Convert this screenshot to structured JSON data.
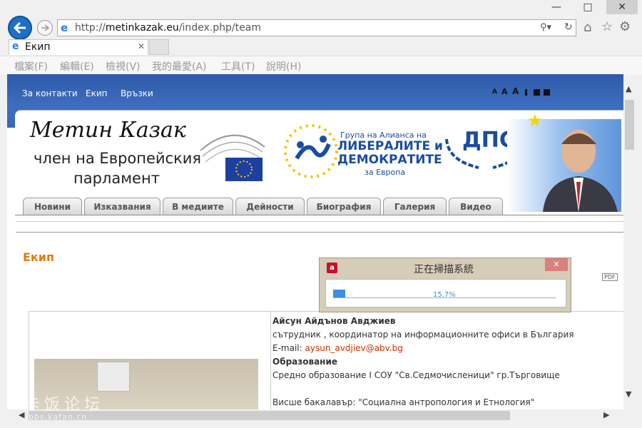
{
  "browser": {
    "url_prefix": "http://",
    "url_domain": "metinkazak.eu",
    "url_path": "/index.php/team",
    "tab_title": "Екип",
    "menu": [
      "檔案(F)",
      "編輯(E)",
      "檢視(V)",
      "我的最愛(A)",
      "工具(T)",
      "說明(H)"
    ]
  },
  "site": {
    "top_links": [
      "За контакти",
      "Екип",
      "Връзки"
    ],
    "font_sizes": [
      "A",
      "A",
      "A"
    ],
    "header_name": "Метин Казак",
    "header_sub1": "член на Европейския",
    "header_sub2": "парламент",
    "alde_line1": "Група на Алианса на",
    "alde_line2": "ЛИБЕРАЛИТЕ и",
    "alde_line3": "ДЕМОКРАТИТЕ",
    "alde_line4": "за Европа",
    "dps": "ДПС",
    "nav": [
      "Новини",
      "Изказвания",
      "В медиите",
      "Дейности",
      "Биография",
      "Галерия",
      "Видео"
    ],
    "page_heading": "Екип",
    "pdf": "PDF"
  },
  "person": {
    "name": "Айсун Айдънов Авджиев",
    "role": "сътрудник , координатор на информационните офиси в България",
    "email_label": "E-mail:",
    "email": "aysun_avdjiev@abv.bg",
    "edu_heading": "Образование",
    "edu1": "Средно образование I СОУ  \"Св.Седмочисленици\" гр.Търговище",
    "edu2": "Висше бакалавър: \"Социална антропология и Етнология\""
  },
  "dialog": {
    "title": "正在掃描系統",
    "progress": 0.157,
    "progress_label": "15.7%"
  },
  "watermark": {
    "text": "卡饭论坛",
    "sub": "bbs.kafan.cn"
  },
  "colors": {
    "topbar": "#3a67b8",
    "heading": "#e07a10",
    "link": "#cc3300",
    "progress": "#3b8ee0"
  }
}
